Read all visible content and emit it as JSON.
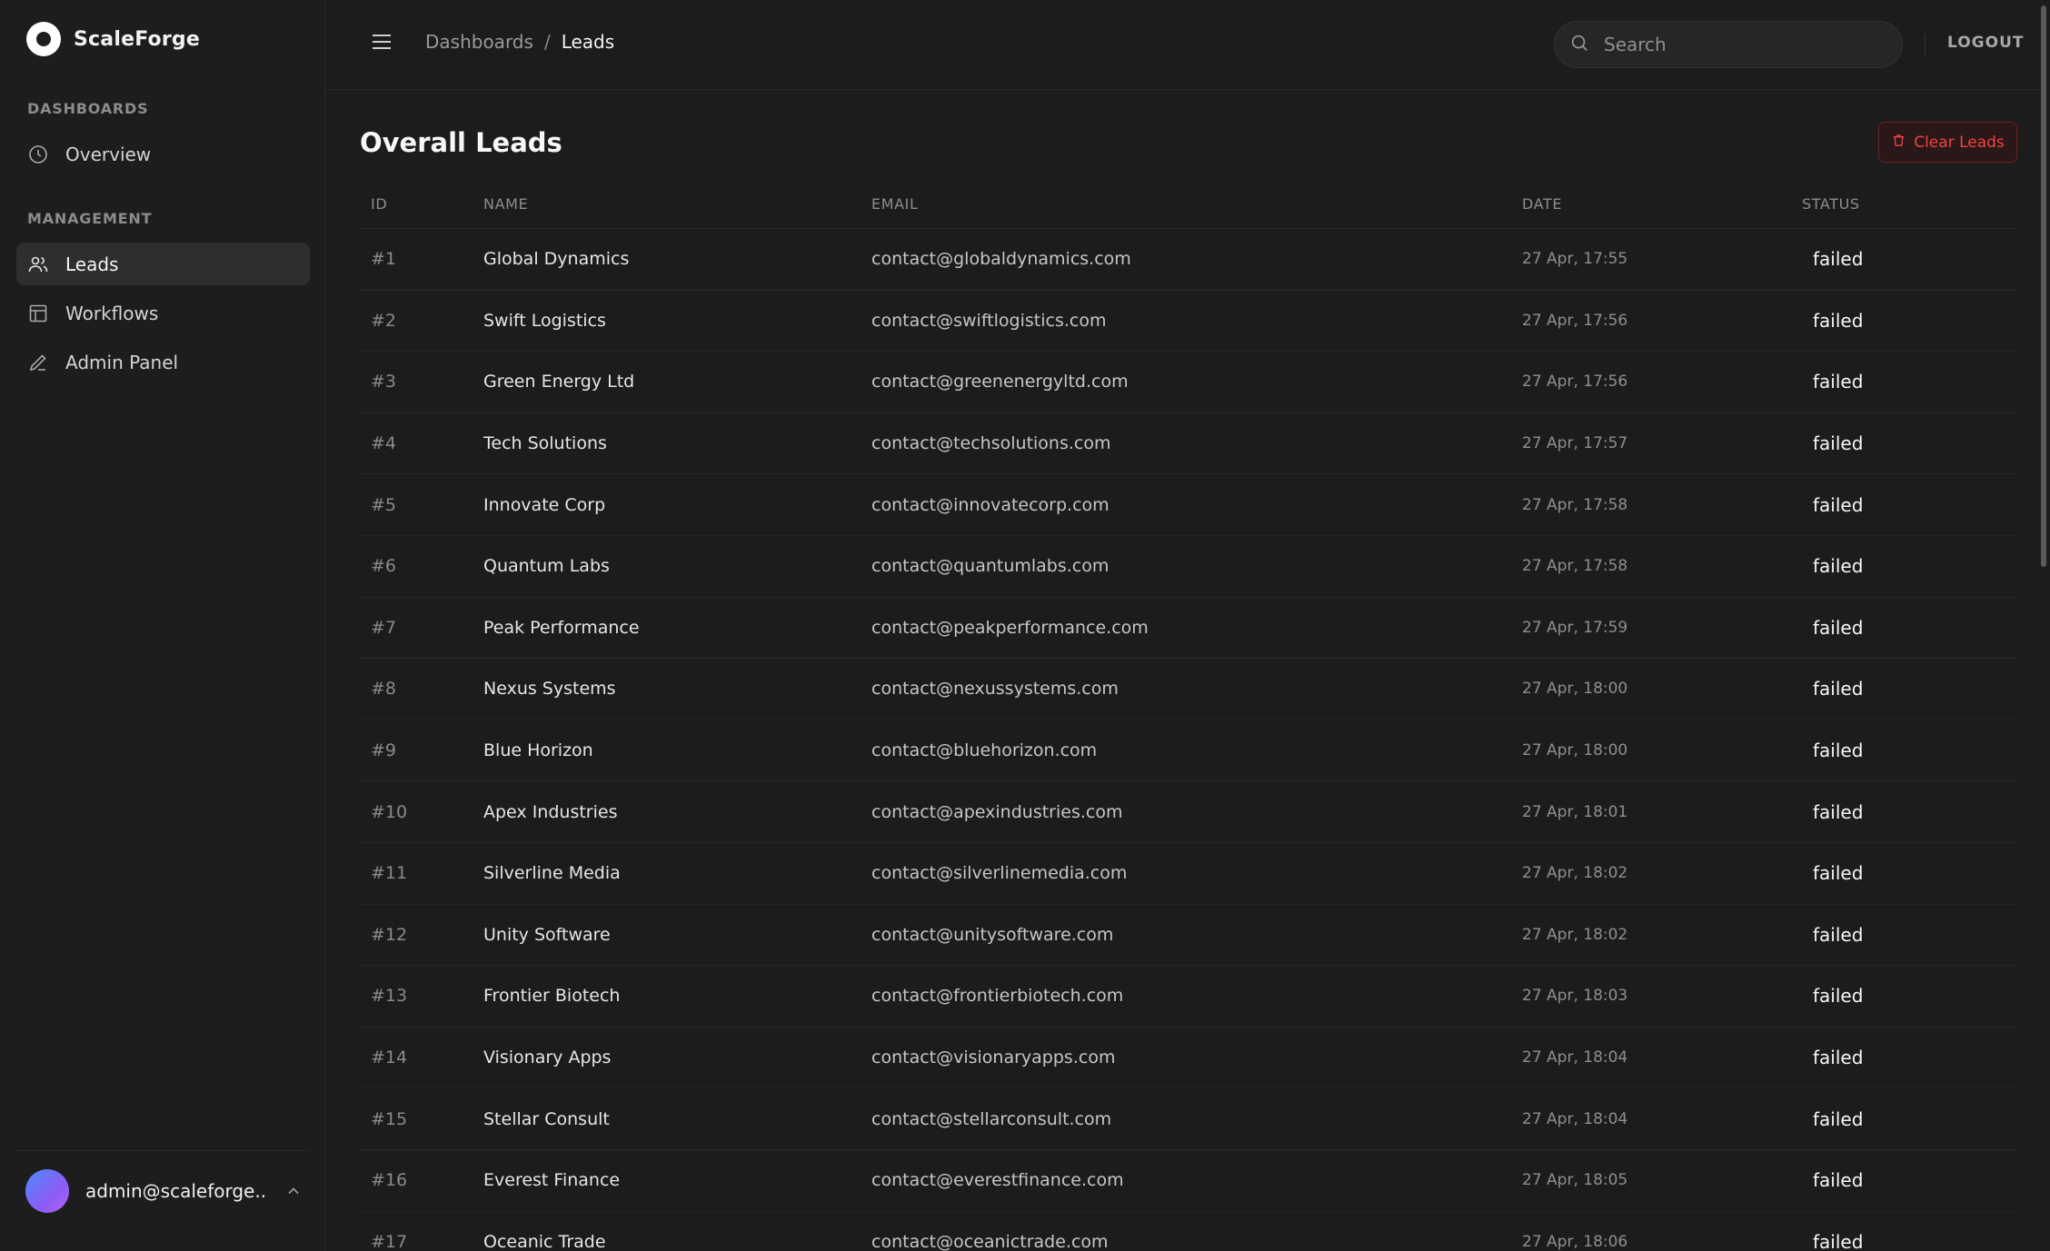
{
  "brand": {
    "name": "ScaleForge"
  },
  "sidebar": {
    "sections": [
      {
        "title": "DASHBOARDS",
        "items": [
          {
            "label": "Overview",
            "icon": "clock-icon"
          }
        ]
      },
      {
        "title": "MANAGEMENT",
        "items": [
          {
            "label": "Leads",
            "icon": "users-icon",
            "active": true
          },
          {
            "label": "Workflows",
            "icon": "layout-icon"
          },
          {
            "label": "Admin Panel",
            "icon": "pencil-icon"
          }
        ]
      }
    ],
    "user": {
      "email": "admin@scaleforge..."
    }
  },
  "topbar": {
    "breadcrumb": {
      "parent": "Dashboards",
      "separator": "/",
      "current": "Leads"
    },
    "search": {
      "placeholder": "Search",
      "value": ""
    },
    "logout_label": "LOGOUT"
  },
  "page": {
    "title": "Overall Leads",
    "clear_label": "Clear Leads"
  },
  "table": {
    "columns": [
      "ID",
      "NAME",
      "EMAIL",
      "DATE",
      "STATUS"
    ],
    "rows": [
      {
        "id": "#1",
        "name": "Global Dynamics",
        "email": "contact@globaldynamics.com",
        "date": "27 Apr, 17:55",
        "status": "failed"
      },
      {
        "id": "#2",
        "name": "Swift Logistics",
        "email": "contact@swiftlogistics.com",
        "date": "27 Apr, 17:56",
        "status": "failed"
      },
      {
        "id": "#3",
        "name": "Green Energy Ltd",
        "email": "contact@greenenergyltd.com",
        "date": "27 Apr, 17:56",
        "status": "failed"
      },
      {
        "id": "#4",
        "name": "Tech Solutions",
        "email": "contact@techsolutions.com",
        "date": "27 Apr, 17:57",
        "status": "failed"
      },
      {
        "id": "#5",
        "name": "Innovate Corp",
        "email": "contact@innovatecorp.com",
        "date": "27 Apr, 17:58",
        "status": "failed"
      },
      {
        "id": "#6",
        "name": "Quantum Labs",
        "email": "contact@quantumlabs.com",
        "date": "27 Apr, 17:58",
        "status": "failed"
      },
      {
        "id": "#7",
        "name": "Peak Performance",
        "email": "contact@peakperformance.com",
        "date": "27 Apr, 17:59",
        "status": "failed"
      },
      {
        "id": "#8",
        "name": "Nexus Systems",
        "email": "contact@nexussystems.com",
        "date": "27 Apr, 18:00",
        "status": "failed"
      },
      {
        "id": "#9",
        "name": "Blue Horizon",
        "email": "contact@bluehorizon.com",
        "date": "27 Apr, 18:00",
        "status": "failed"
      },
      {
        "id": "#10",
        "name": "Apex Industries",
        "email": "contact@apexindustries.com",
        "date": "27 Apr, 18:01",
        "status": "failed"
      },
      {
        "id": "#11",
        "name": "Silverline Media",
        "email": "contact@silverlinemedia.com",
        "date": "27 Apr, 18:02",
        "status": "failed"
      },
      {
        "id": "#12",
        "name": "Unity Software",
        "email": "contact@unitysoftware.com",
        "date": "27 Apr, 18:02",
        "status": "failed"
      },
      {
        "id": "#13",
        "name": "Frontier Biotech",
        "email": "contact@frontierbiotech.com",
        "date": "27 Apr, 18:03",
        "status": "failed"
      },
      {
        "id": "#14",
        "name": "Visionary Apps",
        "email": "contact@visionaryapps.com",
        "date": "27 Apr, 18:04",
        "status": "failed"
      },
      {
        "id": "#15",
        "name": "Stellar Consult",
        "email": "contact@stellarconsult.com",
        "date": "27 Apr, 18:04",
        "status": "failed"
      },
      {
        "id": "#16",
        "name": "Everest Finance",
        "email": "contact@everestfinance.com",
        "date": "27 Apr, 18:05",
        "status": "failed"
      },
      {
        "id": "#17",
        "name": "Oceanic Trade",
        "email": "contact@oceanictrade.com",
        "date": "27 Apr, 18:06",
        "status": "failed"
      }
    ]
  },
  "colors": {
    "background": "#1c1c1c",
    "sidebar_active": "#2e2e2e",
    "danger": "#ef4444",
    "avatar_gradient_start": "#4a8cff",
    "avatar_gradient_end": "#b062f5"
  }
}
